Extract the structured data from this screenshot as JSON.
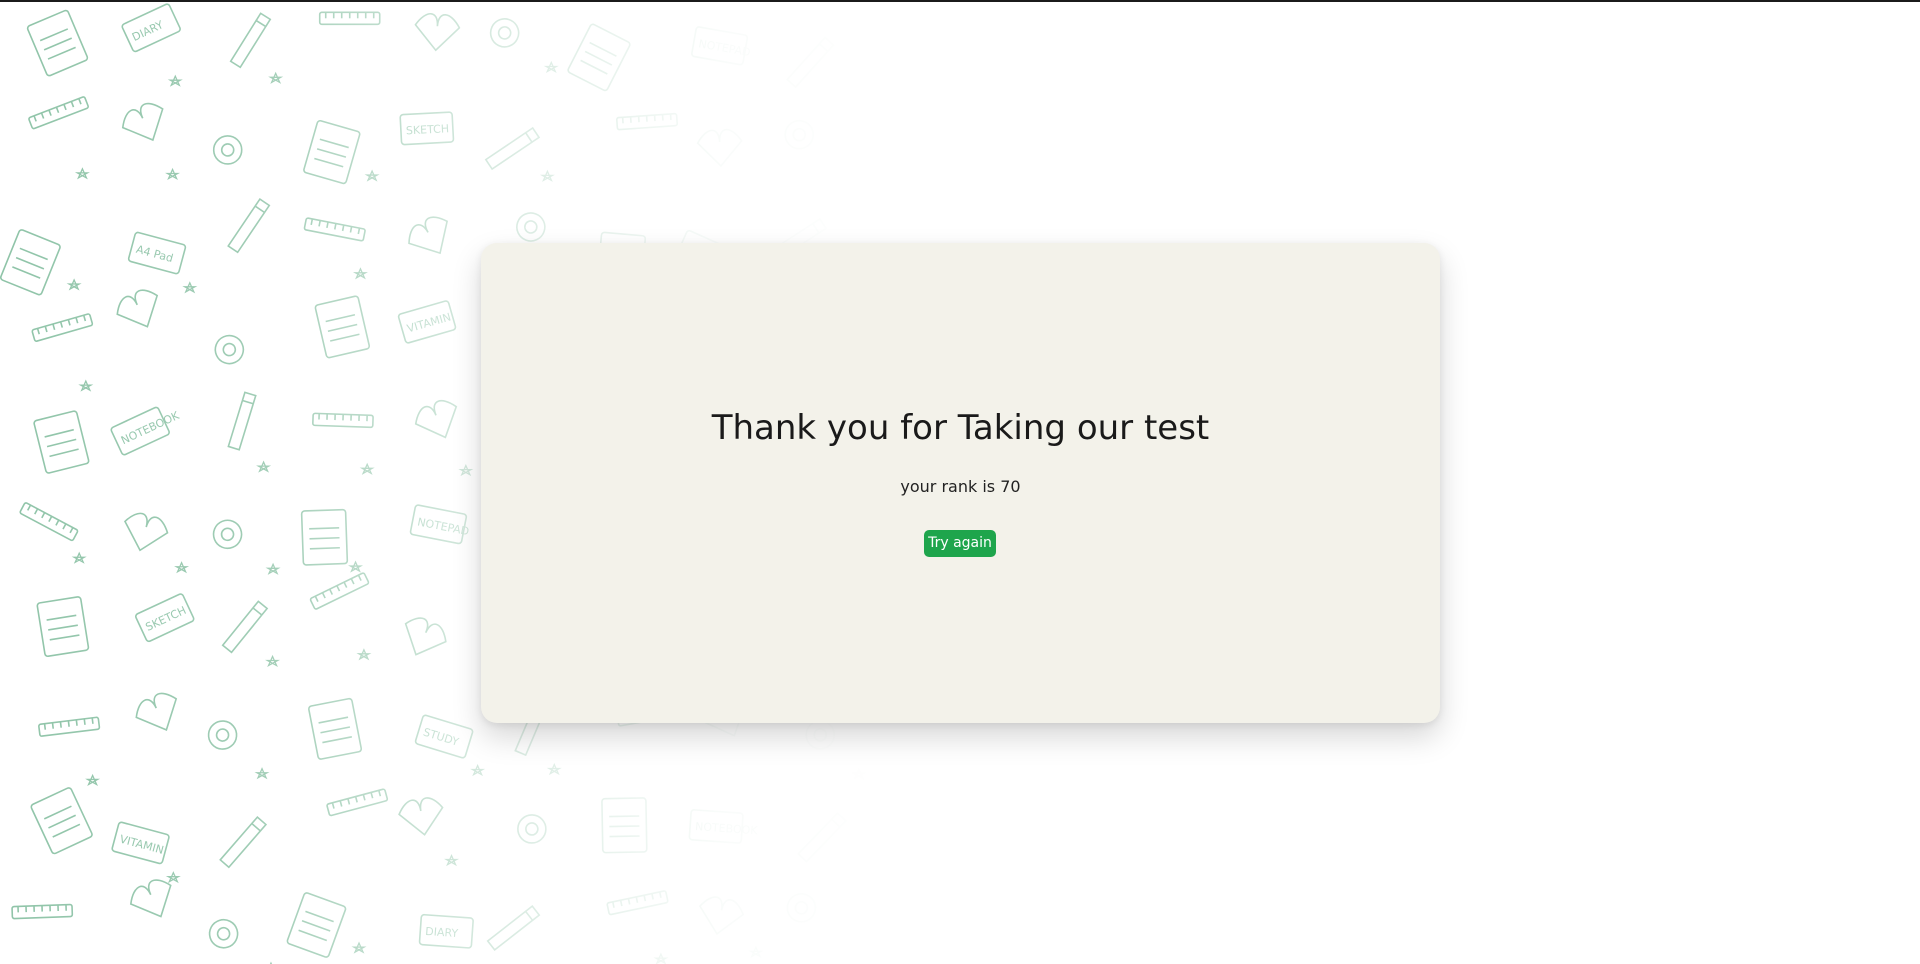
{
  "result": {
    "title": "Thank you for Taking our test",
    "rank_text": "your rank is 70",
    "rank": 70
  },
  "actions": {
    "try_again_label": "Try again"
  },
  "colors": {
    "card_background": "#f3f2ea",
    "button_background": "#1ea54c",
    "button_text": "#ffffff",
    "doodle_stroke": "#8fc4a8"
  },
  "background": {
    "doodle_words": [
      "DIARY",
      "NOTEPAD",
      "SKETCH",
      "A4 Pad",
      "STUDY",
      "VITAMIN",
      "NOTEBOOK"
    ]
  }
}
